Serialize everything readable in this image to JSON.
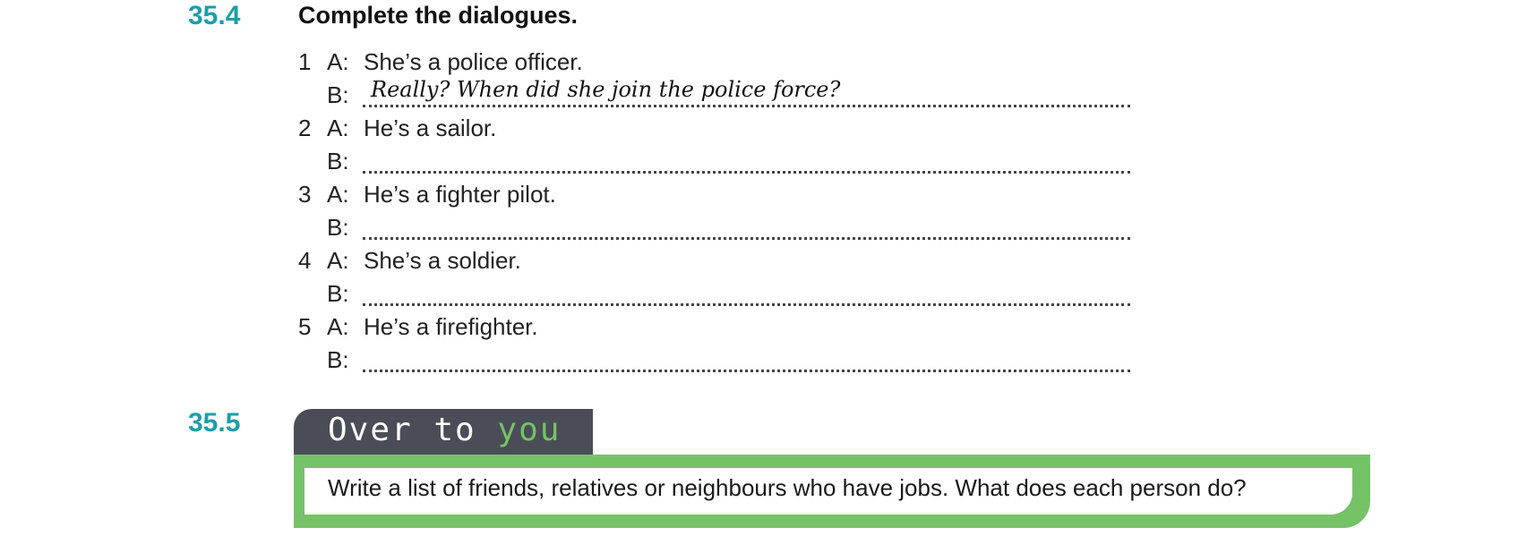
{
  "exercise1": {
    "number": "35.4",
    "title": "Complete the dialogues.",
    "items": [
      {
        "num": "1",
        "a_label": "A:",
        "a_text": "She’s a police officer.",
        "b_label": "B:",
        "b_answer": "Really? When did she join the police force?"
      },
      {
        "num": "2",
        "a_label": "A:",
        "a_text": "He’s a sailor.",
        "b_label": "B:",
        "b_answer": ""
      },
      {
        "num": "3",
        "a_label": "A:",
        "a_text": "He’s a fighter pilot.",
        "b_label": "B:",
        "b_answer": ""
      },
      {
        "num": "4",
        "a_label": "A:",
        "a_text": "She’s a soldier.",
        "b_label": "B:",
        "b_answer": ""
      },
      {
        "num": "5",
        "a_label": "A:",
        "a_text": "He’s a firefighter.",
        "b_label": "B:",
        "b_answer": ""
      }
    ]
  },
  "exercise2": {
    "number": "35.5",
    "banner_part1": "Over to ",
    "banner_part2": "you",
    "instruction": "Write a list of friends, relatives or neighbours who have jobs. What does each person do?"
  },
  "colors": {
    "exercise_number": "#1a9fa8",
    "banner_bg": "#4a4d57",
    "accent_green": "#76c267"
  }
}
